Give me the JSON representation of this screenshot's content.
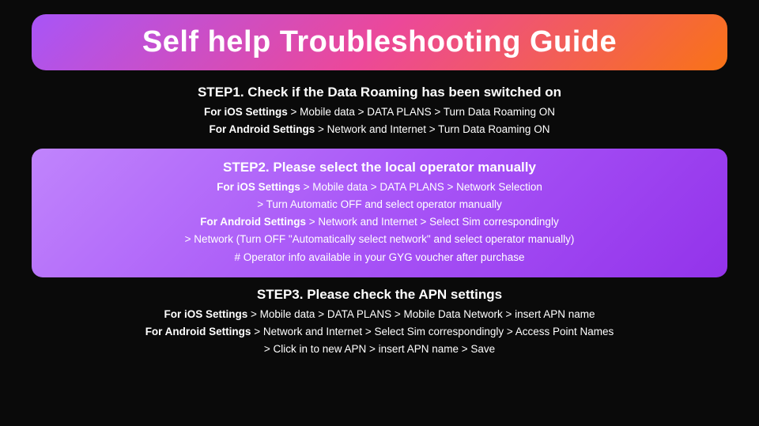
{
  "title": "Self help Troubleshooting Guide",
  "step1": {
    "title": "STEP1. Check if the Data Roaming has been switched on",
    "line1_bold": "For iOS Settings",
    "line1_rest": " > Mobile data > DATA PLANS > Turn Data Roaming ON",
    "line2_bold": "For Android Settings",
    "line2_rest": " > Network and Internet > Turn Data Roaming ON"
  },
  "step2": {
    "title": "STEP2. Please select the local operator manually",
    "line1_bold": "For iOS Settings",
    "line1_rest": " > Mobile data > DATA PLANS > Network Selection",
    "line2": "> Turn Automatic OFF and select operator manually",
    "line3_bold": "For Android Settings",
    "line3_rest": " > Network and Internet > Select Sim correspondingly",
    "line4": "> Network (Turn OFF \"Automatically select network\" and select operator manually)",
    "line5": "# Operator info available in your GYG voucher after purchase"
  },
  "step3": {
    "title": "STEP3. Please check the APN settings",
    "line1_bold": "For iOS Settings",
    "line1_rest": " > Mobile data > DATA PLANS > Mobile Data Network > insert APN name",
    "line2_bold": "For Android Settings",
    "line2_rest": " > Network and Internet > Select Sim correspondingly > Access Point Names",
    "line3": "> Click in to new APN > insert APN name > Save"
  }
}
